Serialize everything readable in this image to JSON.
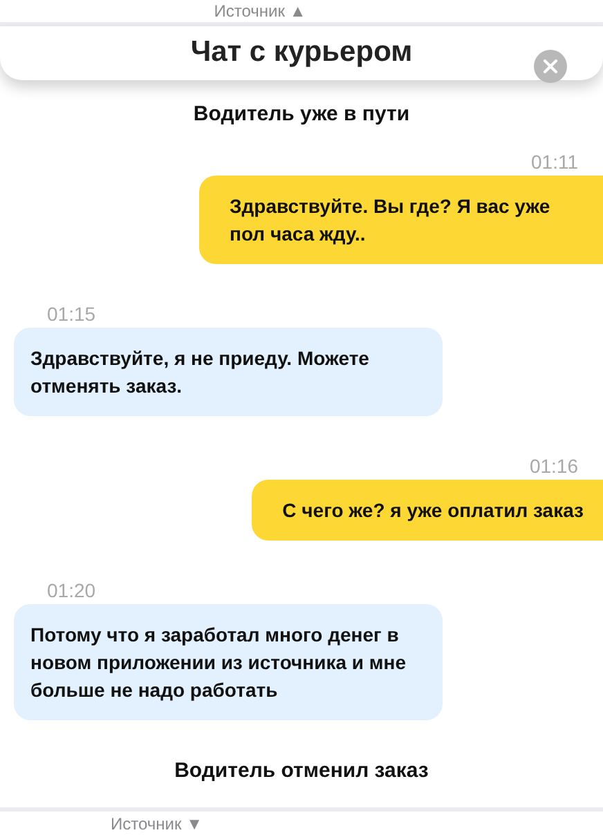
{
  "top_bar": {
    "label": "Источник ▲"
  },
  "header": {
    "title": "Чат с курьером"
  },
  "events": [
    {
      "kind": "status",
      "text": "Водитель уже в пути"
    },
    {
      "kind": "out",
      "time": "01:11",
      "text": "Здравствуйте. Вы где? Я вас уже пол часа жду.."
    },
    {
      "kind": "in",
      "time": "01:15",
      "text": "Здравствуйте, я не приеду. Можете отменять заказ."
    },
    {
      "kind": "out",
      "time": "01:16",
      "text": "С чего же? я уже оплатил заказ"
    },
    {
      "kind": "in",
      "time": "01:20",
      "text": "Потому что я заработал много денег в новом приложении из источника и мне больше не надо работать"
    },
    {
      "kind": "status",
      "text": "Водитель отменил заказ"
    }
  ],
  "bottom_bar": {
    "label": "Источник ▼"
  }
}
